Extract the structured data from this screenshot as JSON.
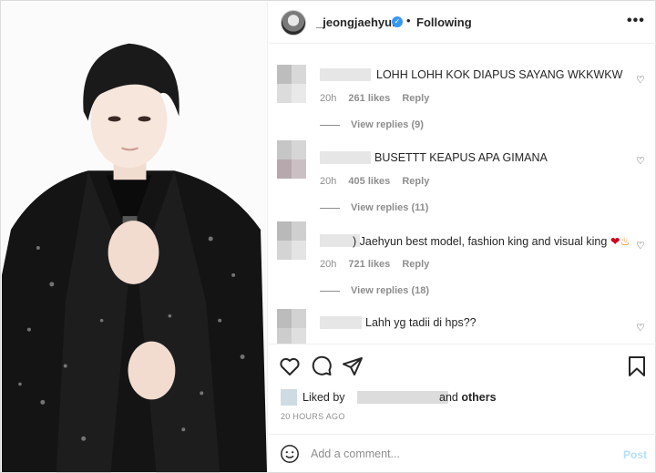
{
  "post": {
    "username": "_jeongjaehyun",
    "follow_status": "Following",
    "separator": "•",
    "verified_mark": "✓",
    "more_label": "•••"
  },
  "comments": [
    {
      "text": "LOHH LOHH KOK DIAPUS SAYANG WKKWKW",
      "time": "20h",
      "likes": "261 likes",
      "reply_label": "Reply",
      "view_replies": "View replies (9)"
    },
    {
      "text": "BUSETTT KEAPUS APA GIMANA",
      "time": "20h",
      "likes": "405 likes",
      "reply_label": "Reply",
      "view_replies": "View replies (11)"
    },
    {
      "text": ") Jaehyun best model, fashion king and visual king",
      "time": "20h",
      "likes": "721 likes",
      "reply_label": "Reply",
      "view_replies": "View replies (18)"
    },
    {
      "text": "Lahh yg tadii di hps??"
    }
  ],
  "icons": {
    "like": "heart-icon",
    "comment": "comment-icon",
    "share": "share-icon",
    "save": "bookmark-icon",
    "emoji": "smiley-icon",
    "comment_like": "small-heart-icon"
  },
  "likes": {
    "liked_by_label": "Liked by",
    "and_label": "and",
    "others_label": "others"
  },
  "timestamp": "20 HOURS AGO",
  "add_comment": {
    "placeholder": "Add a comment...",
    "post_label": "Post"
  },
  "colors": {
    "link_blue_disabled": "#b2dffc",
    "verified_blue": "#3897f0",
    "meta_gray": "#8e8e8e",
    "text": "#262626"
  }
}
